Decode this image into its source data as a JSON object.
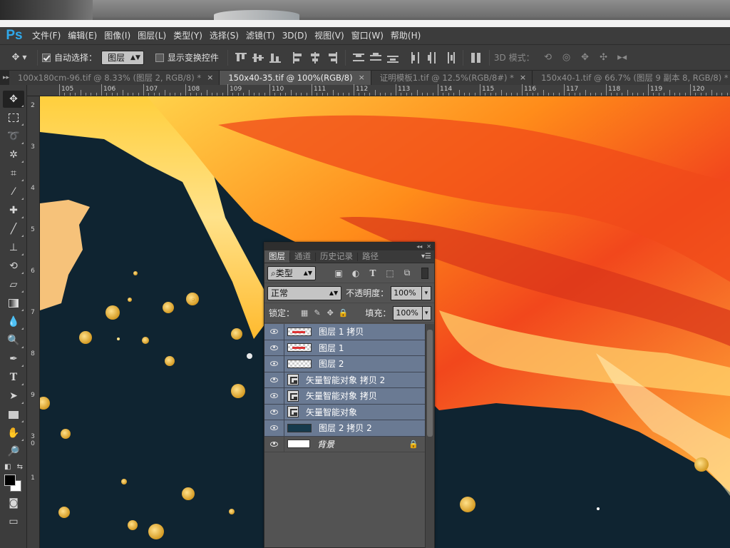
{
  "app": {
    "logo": "Ps"
  },
  "menu": [
    "文件(F)",
    "编辑(E)",
    "图像(I)",
    "图层(L)",
    "类型(Y)",
    "选择(S)",
    "滤镜(T)",
    "3D(D)",
    "视图(V)",
    "窗口(W)",
    "帮助(H)"
  ],
  "options": {
    "auto_select_label": "自动选择：",
    "auto_select_checked": true,
    "auto_select_target": "图层",
    "show_transform_label": "显示变换控件",
    "show_transform_checked": false,
    "mode_3d_label": "3D 模式："
  },
  "tabs": [
    {
      "label": "100x180cm-96.tif @ 8.33% (图层 2, RGB/8) *",
      "active": false
    },
    {
      "label": "150x40-35.tif @ 100%(RGB/8)",
      "active": true
    },
    {
      "label": "证明模板1.tif @ 12.5%(RGB/8#) *",
      "active": false
    },
    {
      "label": "150x40-1.tif @ 66.7% (图层 9 副本 8, RGB/8) *",
      "active": false
    }
  ],
  "ruler_h": [
    "105",
    "106",
    "107",
    "108",
    "109",
    "110",
    "111",
    "112",
    "113",
    "114",
    "115",
    "116",
    "117",
    "118",
    "119",
    "120"
  ],
  "ruler_v": [
    "2",
    "3",
    "4",
    "5",
    "6",
    "7",
    "8",
    "9",
    "3\n0",
    "1"
  ],
  "layers_panel": {
    "tabs": [
      "图层",
      "通道",
      "历史记录",
      "路径"
    ],
    "filter_type": "类型",
    "blend_mode": "正常",
    "opacity_label": "不透明度：",
    "opacity_value": "100%",
    "lock_label": "锁定：",
    "fill_label": "填充：",
    "fill_value": "100%",
    "layers": [
      {
        "name": "图层 1 拷贝",
        "kind": "pixel",
        "selected": true
      },
      {
        "name": "图层 1",
        "kind": "pixel",
        "selected": true
      },
      {
        "name": "图层 2",
        "kind": "pixel",
        "selected": true
      },
      {
        "name": "矢量智能对象 拷贝 2",
        "kind": "smart",
        "selected": true
      },
      {
        "name": "矢量智能对象 拷贝",
        "kind": "smart",
        "selected": true
      },
      {
        "name": "矢量智能对象",
        "kind": "smart",
        "selected": true
      },
      {
        "name": "图层 2 拷贝 2",
        "kind": "pixel",
        "selected": true
      },
      {
        "name": "背景",
        "kind": "background",
        "selected": false
      }
    ]
  },
  "colors": {
    "canvas_bg": "#0f2431",
    "accent": "#2fa8ea",
    "selected_layer": "#6a7a93"
  }
}
